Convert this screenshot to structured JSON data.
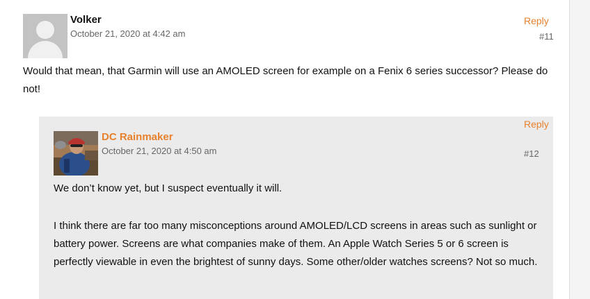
{
  "comments": [
    {
      "author": "Volker",
      "date": "October 21, 2020 at 4:42 am",
      "reply_label": "Reply",
      "number": "#11",
      "avatar_icon": "default-user-avatar-icon",
      "text": "Would that mean, that Garmin will use an AMOLED screen for example on a Fenix 6 series successor? Please do not!"
    },
    {
      "author": "DC Rainmaker",
      "author_color": "#e8812d",
      "date": "October 21, 2020 at 4:50 am",
      "reply_label": "Reply",
      "number": "#12",
      "avatar_icon": "cyclist-photo-avatar",
      "paragraphs": [
        "We don’t know yet, but I suspect eventually it will.",
        "I think there are far too many misconceptions around AMOLED/LCD screens in areas such as sunlight or battery power. Screens are what companies make of them. An Apple Watch Series 5 or 6 screen is perfectly viewable in even the brightest of sunny days. Some other/older watches screens? Not so much."
      ]
    }
  ],
  "colors": {
    "accent": "#e8812d",
    "nested_background": "#ebebeb"
  }
}
